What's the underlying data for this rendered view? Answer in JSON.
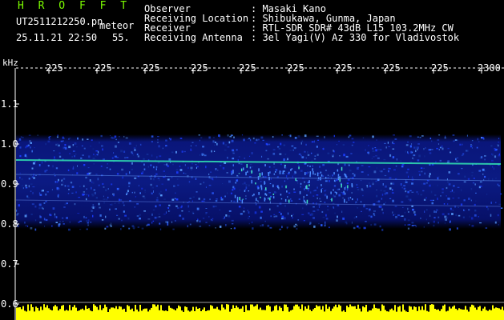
{
  "header": {
    "title": "H R O F F T",
    "filename": "UT2511212250.pn",
    "image_type": "meteor",
    "datetime": "25.11.21 22:50",
    "seconds": "55."
  },
  "station_info": [
    {
      "label": "Observer",
      "value": ": Masaki Kano"
    },
    {
      "label": "Receiving Location",
      "value": ": Shibukawa, Gunma, Japan"
    },
    {
      "label": "Receiver",
      "value": ": RTL-SDR SDR# 43dB L15 103.2MHz CW"
    },
    {
      "label": "Receiving Antenna",
      "value": ": 3el Yagi(V) Az 330 for Vladivostok"
    }
  ],
  "spectrogram": {
    "y_unit_label": "kHz",
    "y_tick_labels": [
      "1.1",
      "1.0",
      "0.9",
      "0.8",
      "0.7",
      "0.6"
    ],
    "x_tick_labels": [
      "225",
      "225",
      "225",
      "225",
      "225",
      "225",
      "225",
      "225",
      "225",
      "2300"
    ],
    "colors": {
      "background": "#000000",
      "noise_band": "#0a1a8c",
      "carrier_line": "#00ffaa",
      "signal_peak": "#ffff00",
      "tick": "#ffffff"
    }
  }
}
